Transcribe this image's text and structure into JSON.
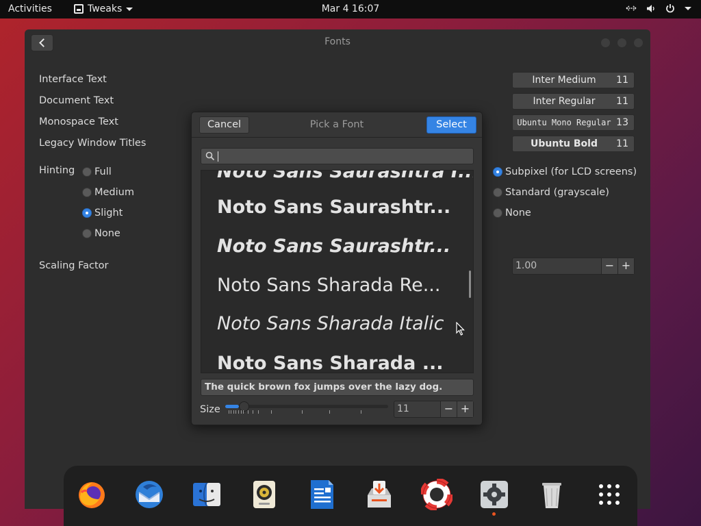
{
  "topbar": {
    "activities": "Activities",
    "app_name": "Tweaks",
    "clock": "Mar 4  16:07"
  },
  "window": {
    "title": "Fonts",
    "rows": {
      "interface": {
        "label": "Interface Text",
        "font": "Inter Medium",
        "size": "11"
      },
      "document": {
        "label": "Document Text",
        "font": "Inter Regular",
        "size": "11"
      },
      "monospace": {
        "label": "Monospace Text",
        "font": "Ubuntu Mono Regular",
        "size": "13"
      },
      "legacy": {
        "label": "Legacy Window Titles",
        "font": "Ubuntu Bold",
        "size": "11"
      }
    },
    "hinting": {
      "label": "Hinting",
      "options": [
        "Full",
        "Medium",
        "Slight",
        "None"
      ],
      "selected": "Slight"
    },
    "antialiasing": {
      "options": [
        "Subpixel (for LCD screens)",
        "Standard (grayscale)",
        "None"
      ],
      "selected": "Subpixel (for LCD screens)"
    },
    "scaling": {
      "label": "Scaling Factor",
      "value": "1.00",
      "minus": "−",
      "plus": "+"
    }
  },
  "dialog": {
    "title": "Pick a Font",
    "cancel": "Cancel",
    "select": "Select",
    "search_value": "",
    "fonts": [
      "Noto Sans Saurashtra I...",
      "Noto Sans Saurashtr...",
      "Noto Sans Saurashtr...",
      "Noto Sans Sharada Re...",
      "Noto Sans Sharada Italic",
      "Noto Sans Sharada ..."
    ],
    "preview_text": "The quick brown fox jumps over the lazy dog.",
    "size_label": "Size",
    "size_value": "11",
    "size_slider_fraction": 0.06,
    "minus": "−",
    "plus": "+"
  },
  "dock": {
    "apps": [
      "firefox-icon",
      "thunderbird-icon",
      "files-icon",
      "rhythmbox-icon",
      "writer-icon",
      "software-icon",
      "help-icon",
      "tweaks-icon",
      "trash-icon",
      "app-grid-icon"
    ]
  },
  "colors": {
    "accent": "#3584e4",
    "running_indicator": "#e95420"
  }
}
